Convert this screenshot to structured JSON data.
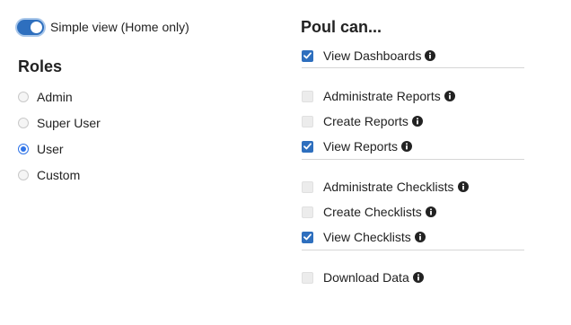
{
  "simple_view": {
    "label": "Simple view (Home only)",
    "enabled": true
  },
  "roles": {
    "heading": "Roles",
    "options": [
      {
        "label": "Admin",
        "selected": false
      },
      {
        "label": "Super User",
        "selected": false
      },
      {
        "label": "User",
        "selected": true
      },
      {
        "label": "Custom",
        "selected": false
      }
    ]
  },
  "permissions": {
    "heading": "Poul can...",
    "items": [
      {
        "label": "View Dashboards",
        "checked": true
      },
      {
        "label": "Administrate Reports",
        "checked": false
      },
      {
        "label": "Create Reports",
        "checked": false
      },
      {
        "label": "View Reports",
        "checked": true
      },
      {
        "label": "Administrate Checklists",
        "checked": false
      },
      {
        "label": "Create Checklists",
        "checked": false
      },
      {
        "label": "View Checklists",
        "checked": true
      },
      {
        "label": "Download Data",
        "checked": false
      }
    ],
    "icon": "info-circle-icon"
  },
  "colors": {
    "accent": "#2e6fbe",
    "radio_selected": "#2f74e8",
    "divider": "#d6d6d6",
    "disabled_checkbox": "#ececec"
  }
}
